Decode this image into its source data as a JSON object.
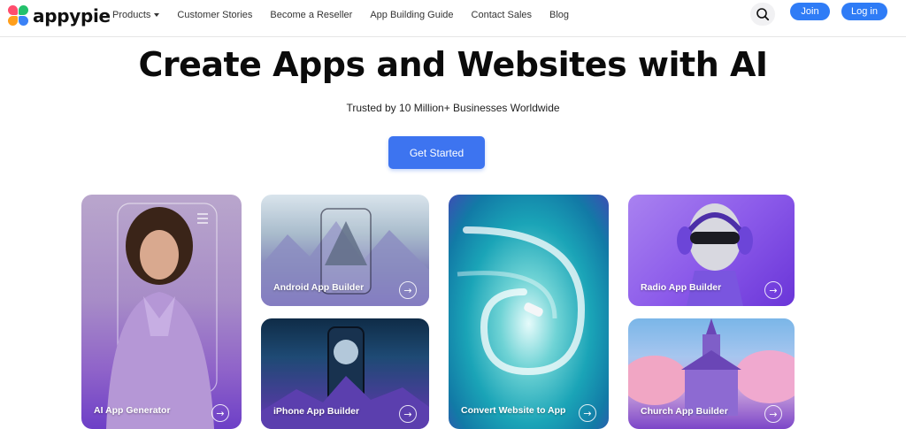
{
  "brand": {
    "name": "appypie"
  },
  "nav": {
    "items": [
      {
        "label": "Products",
        "has_dropdown": true
      },
      {
        "label": "Customer Stories"
      },
      {
        "label": "Become a Reseller"
      },
      {
        "label": "App Building Guide"
      },
      {
        "label": "Contact Sales"
      },
      {
        "label": "Blog"
      }
    ],
    "join_label": "Join",
    "login_label": "Log in",
    "search_icon": "search-icon"
  },
  "hero": {
    "title": "Create Apps and Websites with AI",
    "subtitle": "Trusted by 10 Million+ Businesses Worldwide",
    "cta_label": "Get Started"
  },
  "cards": {
    "ai": {
      "label": "AI App Generator"
    },
    "android": {
      "label": "Android App Builder"
    },
    "iphone": {
      "label": "iPhone App Builder"
    },
    "convert": {
      "label": "Convert Website to App"
    },
    "radio": {
      "label": "Radio App Builder"
    },
    "church": {
      "label": "Church App Builder"
    }
  },
  "colors": {
    "primary_button": "#2f7cf6",
    "cta_button": "#3d74f0",
    "card_purple": "#6a35d8"
  }
}
